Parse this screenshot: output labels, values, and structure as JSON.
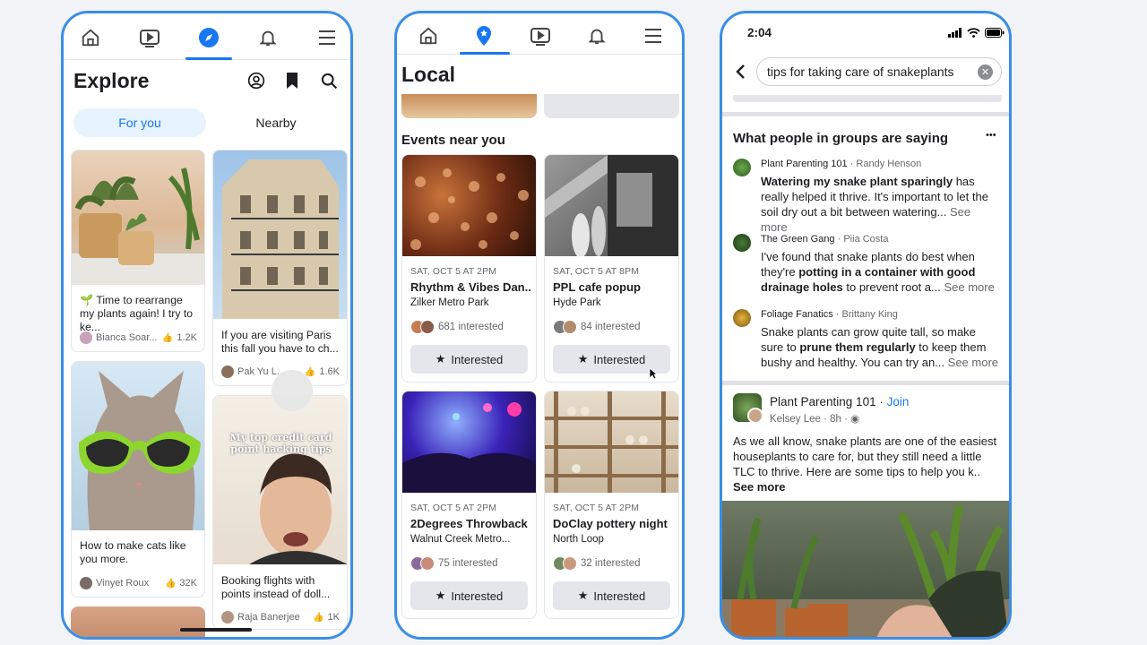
{
  "explore": {
    "title": "Explore",
    "tabs": [
      "For you",
      "Nearby"
    ],
    "cards": [
      {
        "caption": "🌱 Time to rearrange my plants again! I try to ke...",
        "author": "Bianca Soar...",
        "likes": "1.2K"
      },
      {
        "caption": "If you are visiting Paris this fall you have to ch...",
        "author": "Pak Yu L...",
        "likes": "1.6K"
      },
      {
        "caption": "How to make cats like you more.",
        "author": "Vinyet Roux",
        "likes": "32K"
      },
      {
        "overlay": "My top credit card point hacking tips",
        "caption": "Booking flights with points instead of doll...",
        "author": "Raja Banerjee",
        "likes": "1K"
      }
    ]
  },
  "local": {
    "title": "Local",
    "section": "Events near you",
    "button_label": "Interested",
    "events": [
      {
        "date": "SAT, OCT 5 AT 2PM",
        "title": "Rhythm & Vibes Dan...",
        "location": "Zilker Metro Park",
        "interested": "681 interested"
      },
      {
        "date": "SAT, OCT 5 AT 8PM",
        "title": "PPL cafe popup",
        "location": "Hyde Park",
        "interested": "84 interested"
      },
      {
        "date": "SAT, OCT 5 AT 2PM",
        "title": "2Degrees Throwback",
        "location": "Walnut Creek Metro...",
        "interested": "75 interested"
      },
      {
        "date": "SAT, OCT 5 AT 2PM",
        "title": "DoClay pottery night",
        "location": "North Loop",
        "interested": "32 interested"
      }
    ]
  },
  "search": {
    "time": "2:04",
    "query": "tips for taking care of snakeplants",
    "section_title": "What people in groups are saying",
    "more": "•••",
    "comments": [
      {
        "group": "Plant Parenting 101",
        "author": "Randy Henson",
        "parts": [
          [
            "b",
            "Watering my snake plant sparingly"
          ],
          [
            "t",
            " has really helped it thrive. It's important to let the soil dry out a bit between watering..."
          ],
          [
            "m",
            " See more"
          ]
        ]
      },
      {
        "group": "The Green Gang",
        "author": "Piia Costa",
        "parts": [
          [
            "t",
            "I've found that snake plants do best when they're "
          ],
          [
            "b",
            "potting in a container with good drainage holes"
          ],
          [
            "t",
            " to prevent root a..."
          ],
          [
            "m",
            " See more"
          ]
        ]
      },
      {
        "group": "Foliage Fanatics",
        "author": "Brittany King",
        "parts": [
          [
            "t",
            "Snake plants can grow quite tall, so make sure to "
          ],
          [
            "b",
            "prune them regularly"
          ],
          [
            "t",
            " to keep them bushy and healthy. You can try an..."
          ],
          [
            "m",
            " See more"
          ]
        ]
      }
    ],
    "post": {
      "group": "Plant Parenting 101",
      "join": "Join",
      "author": "Kelsey Lee",
      "time": "8h",
      "body": "As we all know, snake plants are one of the easiest houseplants to care for, but they still need a little TLC to thrive. Here are some tips to help you k..",
      "see_more": "See more"
    }
  },
  "colors": {
    "accent": "#1877f2",
    "frame": "#3a8ee6"
  }
}
